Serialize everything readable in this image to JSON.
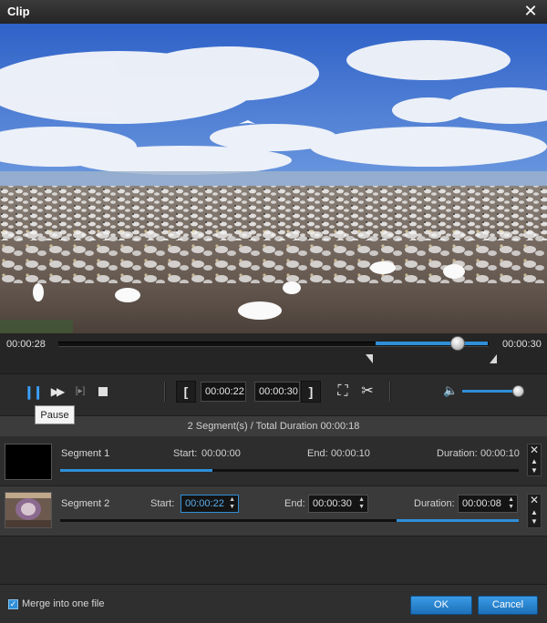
{
  "window": {
    "title": "Clip",
    "close_icon": "close-icon"
  },
  "player": {
    "current_time": "00:00:28",
    "total_time": "00:00:30",
    "progress": 0.933,
    "clip_start_fraction": 0.733,
    "clip_end_fraction": 1.0
  },
  "controls": {
    "start_time": "00:00:22",
    "end_time": "00:00:30",
    "pause_icon": "pause-icon",
    "fast_forward_icon": "fast-forward-icon",
    "next_frame_icon": "next-frame-icon",
    "stop_icon": "stop-icon",
    "set_start_icon": "set-start-bracket-icon",
    "set_end_icon": "set-end-bracket-icon",
    "crop_icon": "crop-icon",
    "split_icon": "scissors-icon",
    "volume_icon": "volume-icon",
    "volume_level": 0.95
  },
  "tooltip": "Pause",
  "summary": "2 Segment(s) / Total Duration 00:00:18",
  "segments": [
    {
      "name": "Segment 1",
      "start_label": "Start:",
      "start": "00:00:00",
      "end_label": "End:",
      "end": "00:00:10",
      "duration_label": "Duration:",
      "duration": "00:00:10",
      "range_start_fraction": 0.0,
      "range_end_fraction": 0.333
    },
    {
      "name": "Segment 2",
      "start_label": "Start:",
      "start": "00:00:22",
      "end_label": "End:",
      "end": "00:00:30",
      "duration_label": "Duration:",
      "duration": "00:00:08",
      "range_start_fraction": 0.733,
      "range_end_fraction": 1.0
    }
  ],
  "footer": {
    "merge_label": "Merge into one file",
    "merge_checked": true,
    "ok_label": "OK",
    "cancel_label": "Cancel"
  },
  "colors": {
    "accent": "#2f8fd8",
    "background": "#2b2b2b"
  }
}
